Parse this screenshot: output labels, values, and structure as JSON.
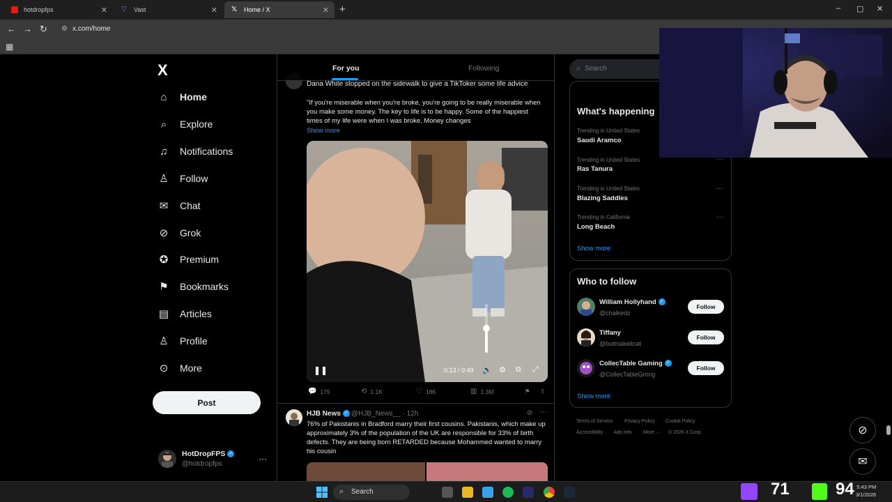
{
  "browser": {
    "tabs": [
      {
        "title": "hotdropfps",
        "icon": "twitch-tab-icon",
        "color": "#e91916",
        "active": false
      },
      {
        "title": "Vast",
        "icon": "vast-tab-icon",
        "color": "#9b5de5",
        "active": false
      },
      {
        "title": "Home / X",
        "icon": "x-tab-icon",
        "color": "#ffffff",
        "active": true
      }
    ],
    "new_tab": "+",
    "url": "x.com/home",
    "window_controls": [
      "–",
      "▢",
      "✕"
    ]
  },
  "nav": {
    "logo": "X",
    "items": [
      {
        "label": "Home",
        "icon": "home-icon",
        "glyph": "⌂"
      },
      {
        "label": "Explore",
        "icon": "search-icon",
        "glyph": "⌕"
      },
      {
        "label": "Notifications",
        "icon": "bell-icon",
        "glyph": "🔔"
      },
      {
        "label": "Follow",
        "icon": "add-person-icon",
        "glyph": "👤"
      },
      {
        "label": "Chat",
        "icon": "envelope-icon",
        "glyph": "✉"
      },
      {
        "label": "Grok",
        "icon": "grok-icon",
        "glyph": "⊘"
      },
      {
        "label": "Premium",
        "icon": "verified-badge-icon",
        "glyph": "✪"
      },
      {
        "label": "Bookmarks",
        "icon": "bookmark-icon",
        "glyph": "🔖"
      },
      {
        "label": "Articles",
        "icon": "articles-icon",
        "glyph": "▤"
      },
      {
        "label": "Profile",
        "icon": "person-icon",
        "glyph": "♙"
      },
      {
        "label": "More",
        "icon": "more-circle-icon",
        "glyph": "⋯"
      }
    ],
    "post_label": "Post",
    "account": {
      "name": "HotDropFPS",
      "handle": "@hotdropfps",
      "more": "···"
    }
  },
  "feed": {
    "tabs": [
      {
        "label": "For you",
        "active": true
      },
      {
        "label": "Following",
        "active": false
      }
    ],
    "post1": {
      "headline": "Dana White stopped on the sidewalk to give a TikToker some life advice",
      "body": "\"If you're miserable when you're broke, you're going to be really miserable when you make some money. The key to life is to be happy. Some of the happiest times of my life were when I was broke. Money changes",
      "show_more": "Show more",
      "video": {
        "time": "0:13 / 0:49",
        "volume_level": 0.5
      },
      "metrics": {
        "replies": "175",
        "reposts": "1.1K",
        "likes": "18K",
        "views": "1.3M"
      }
    },
    "post2": {
      "author": "HJB News",
      "handle_time": "@HJB_News__ · 12h",
      "body": "76% of Pakistanis in Bradford marry their first cousins. Pakistanis, which make up approximately 3% of the population of the UK are responsible for 33% of birth defects. They are being born RETARDED because Mohammed wanted to marry his cousin"
    }
  },
  "sidebar": {
    "search_placeholder": "Search",
    "trends_title": "What's happening",
    "trends": [
      {
        "context": "Trending in United States",
        "name": "Saudi Aramco"
      },
      {
        "context": "Trending in United States",
        "name": "Ras Tanura"
      },
      {
        "context": "Trending in United States",
        "name": "Blazing Saddles"
      },
      {
        "context": "Trending in California",
        "name": "Long Beach"
      }
    ],
    "trends_show_more": "Show more",
    "wtf_title": "Who to follow",
    "wtf": [
      {
        "name": "William Hollyhand",
        "handle": "@chalkedz",
        "verified": true,
        "button": "Follow"
      },
      {
        "name": "Tiffany",
        "handle": "@butmakeitcat",
        "verified": false,
        "button": "Follow"
      },
      {
        "name": "CollecTable Gaming",
        "handle": "@CollecTableGmng",
        "verified": true,
        "button": "Follow"
      }
    ],
    "wtf_show_more": "Show more",
    "footer": [
      "Terms of Service",
      "Privacy Policy",
      "Cookie Policy",
      "Accessibility",
      "Ads info",
      "More ···",
      "© 2026 X Corp."
    ]
  },
  "taskbar": {
    "search_label": "Search",
    "stat1": "71",
    "stat2": "94",
    "clock_time": "5:43 PM",
    "clock_date": "3/1/2026"
  },
  "colors": {
    "accent": "#1d9bf0",
    "background": "#000000",
    "border": "#2f3336",
    "muted": "#71767b"
  }
}
